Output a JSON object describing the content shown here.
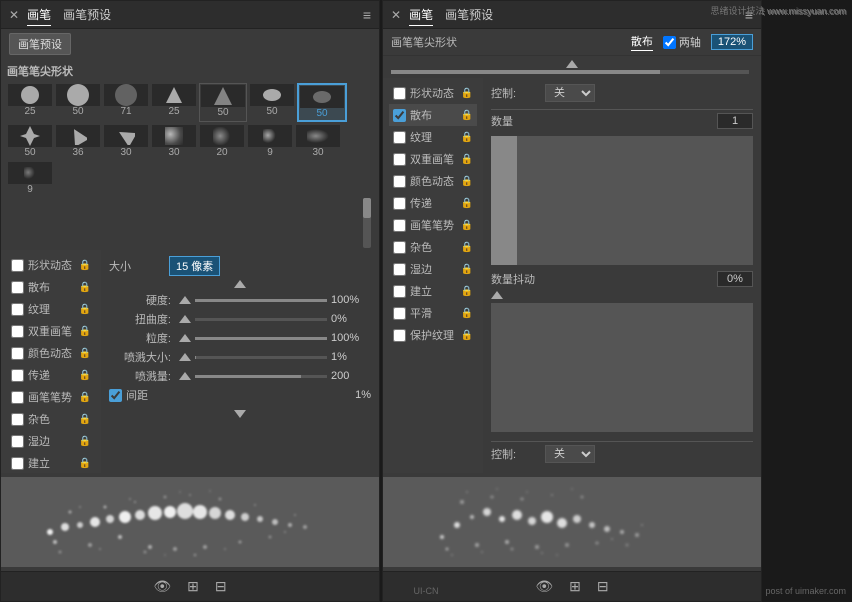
{
  "watermark": {
    "top": "思绪设计技法 www.missyuan.com",
    "bottom_right": "post of uimaker.com",
    "bottom_center": "UI-CN"
  },
  "left_panel": {
    "title": "画笔",
    "tab2": "画笔预设",
    "menu_icon": "≡",
    "preset_btn": "画笔预设",
    "brush_tip_label": "画笔笔尖形状",
    "brush_sizes": [
      25,
      50,
      71,
      25,
      50,
      50,
      50,
      50,
      36,
      30,
      30,
      20,
      9,
      30,
      9
    ],
    "selected_size": 50,
    "size_label": "大小",
    "size_value": "15 像素",
    "hardness_label": "硬度:",
    "hardness_value": "100%",
    "angle_label": "扭曲度:",
    "angle_value": "0%",
    "grain_label": "粒度:",
    "grain_value": "100%",
    "spray_size_label": "喷溅大小:",
    "spray_size_value": "1%",
    "spray_amount_label": "喷溅量:",
    "spray_amount_value": "200",
    "spacing_check": true,
    "spacing_label": "间距",
    "spacing_value": "1%",
    "sidebar_items": [
      {
        "label": "形状动态",
        "checked": false,
        "locked": true
      },
      {
        "label": "散布",
        "checked": false,
        "locked": true
      },
      {
        "label": "纹理",
        "checked": false,
        "locked": false
      },
      {
        "label": "双重画笔",
        "checked": false,
        "locked": false
      },
      {
        "label": "颜色动态",
        "checked": false,
        "locked": false
      },
      {
        "label": "传递",
        "checked": false,
        "locked": false
      },
      {
        "label": "画笔笔势",
        "checked": false,
        "locked": false
      },
      {
        "label": "杂色",
        "checked": false,
        "locked": false
      },
      {
        "label": "湿边",
        "checked": false,
        "locked": false
      },
      {
        "label": "建立",
        "checked": false,
        "locked": false
      },
      {
        "label": "平滑",
        "checked": false,
        "locked": false
      },
      {
        "label": "保护纹理",
        "checked": false,
        "locked": false
      }
    ],
    "bottom_icons": [
      "👁",
      "⊞",
      "⊟"
    ]
  },
  "right_panel": {
    "title": "画笔",
    "tab2": "画笔预设",
    "menu_icon": "≡",
    "active_tab": "散布",
    "brush_tip_label": "画笔笔尖形状",
    "scatter_label": "散布",
    "biaxis_check": true,
    "biaxis_label": "两轴",
    "scatter_value": "172%",
    "control_label": "控制:",
    "control_value": "关",
    "scatter_count_label": "数量",
    "scatter_count_value": "1",
    "jitter_label": "数量抖动",
    "jitter_value": "0%",
    "control2_label": "控制:",
    "control2_value": "关",
    "sidebar_items": [
      {
        "label": "形状动态",
        "checked": false,
        "locked": true
      },
      {
        "label": "散布",
        "checked": true,
        "locked": true
      },
      {
        "label": "纹理",
        "checked": false,
        "locked": false
      },
      {
        "label": "双重画笔",
        "checked": false,
        "locked": false
      },
      {
        "label": "颜色动态",
        "checked": false,
        "locked": false
      },
      {
        "label": "传递",
        "checked": false,
        "locked": false
      },
      {
        "label": "画笔笔势",
        "checked": false,
        "locked": false
      },
      {
        "label": "杂色",
        "checked": false,
        "locked": false
      },
      {
        "label": "湿边",
        "checked": false,
        "locked": false
      },
      {
        "label": "建立",
        "checked": false,
        "locked": false
      },
      {
        "label": "平滑",
        "checked": false,
        "locked": false
      },
      {
        "label": "保护纹理",
        "checked": false,
        "locked": false
      }
    ],
    "bottom_icons": [
      "👁",
      "⊞",
      "⊟"
    ]
  }
}
